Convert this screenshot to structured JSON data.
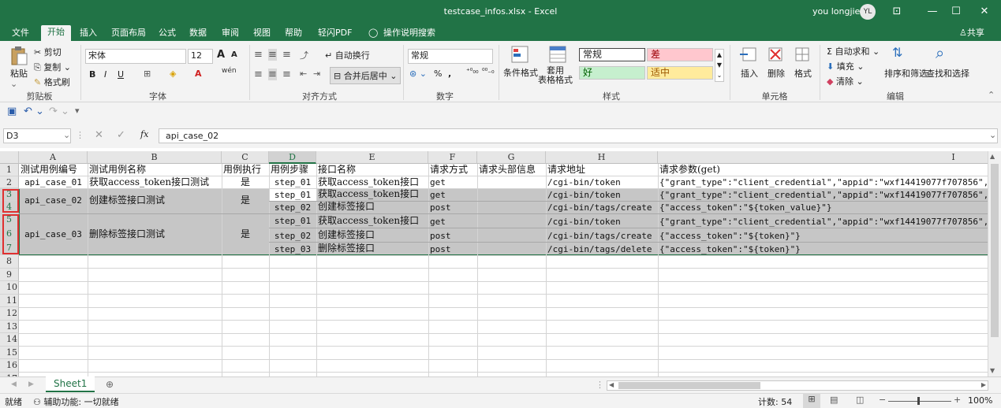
{
  "window": {
    "title": "testcase_infos.xlsx  -  Excel",
    "user": "you longjie",
    "avatar_initials": "YL",
    "controls": [
      "⊡",
      "—",
      "☐",
      "✕"
    ]
  },
  "tabs": [
    "文件",
    "开始",
    "插入",
    "页面布局",
    "公式",
    "数据",
    "审阅",
    "视图",
    "帮助",
    "轻闪PDF",
    "操作说明搜索"
  ],
  "share_label": "共享",
  "ribbon": {
    "clipboard": {
      "paste": "粘贴",
      "cut": "剪切",
      "copy": "复制",
      "format_painter": "格式刷",
      "group": "剪贴板"
    },
    "font": {
      "name": "宋体",
      "size": "12",
      "grow": "A",
      "shrink": "A",
      "bold": "B",
      "italic": "I",
      "underline": "U",
      "wen": "wén",
      "group": "字体"
    },
    "alignment": {
      "wrap": "自动换行",
      "merge": "合并后居中",
      "group": "对齐方式"
    },
    "number": {
      "format": "常规",
      "percent": "%",
      "comma": ",",
      "group": "数字"
    },
    "styles": {
      "cond_format": "条件格式",
      "table_format": "套用\n表格格式",
      "normal": "常规",
      "bad": "差",
      "good": "好",
      "neutral": "适中",
      "group": "样式"
    },
    "cells": {
      "insert": "插入",
      "delete": "删除",
      "format": "格式",
      "group": "单元格"
    },
    "editing": {
      "autosum": "自动求和",
      "fill": "填充",
      "clear": "清除",
      "sort": "排序和筛选",
      "find": "查找和选择",
      "group": "编辑"
    }
  },
  "formula_bar": {
    "name_box": "D3",
    "fx": "fx",
    "value": "api_case_02"
  },
  "columns": [
    "A",
    "B",
    "C",
    "D",
    "E",
    "F",
    "G",
    "H",
    "I"
  ],
  "rows_numbers": [
    "1",
    "2",
    "3",
    "4",
    "5",
    "6",
    "7",
    "8",
    "9",
    "10",
    "11",
    "12",
    "13",
    "14",
    "15",
    "16",
    "17"
  ],
  "cells": {
    "r1": {
      "a": "测试用例编号",
      "b": "测试用例名称",
      "c": "用例执行",
      "d": "用例步骤",
      "e": "接口名称",
      "f": "请求方式",
      "g": "请求头部信息",
      "h": "请求地址",
      "i": "请求参数(get)"
    },
    "r2": {
      "a": "api_case_01",
      "b": "获取access_token接口测试",
      "c": "是",
      "d": "step_01",
      "e": "获取access_token接口",
      "f": "get",
      "h": "/cgi-bin/token",
      "i": "{\"grant_type\":\"client_credential\",\"appid\":\"wxf14419077f707856\",\""
    },
    "r3": {
      "d": "step_01",
      "e": "获取access_token接口",
      "f": "get",
      "h": "/cgi-bin/token",
      "i": "{\"grant_type\":\"client_credential\",\"appid\":\"wxf14419077f707856\",\""
    },
    "r4": {
      "d": "step_02",
      "e": "创建标签接口",
      "f": "post",
      "h": "/cgi-bin/tags/create",
      "i": "{\"access_token\":\"${token_value}\"}"
    },
    "m34": {
      "a": "api_case_02",
      "b": "创建标签接口测试",
      "c": "是"
    },
    "r5": {
      "d": "step_01",
      "e": "获取access_token接口",
      "f": "get",
      "h": "/cgi-bin/token",
      "i": "{\"grant_type\":\"client_credential\",\"appid\":\"wxf14419077f707856\",\""
    },
    "r6": {
      "d": "step_02",
      "e": "创建标签接口",
      "f": "post",
      "h": "/cgi-bin/tags/create",
      "i": "{\"access_token\":\"${token}\"}"
    },
    "r7": {
      "d": "step_03",
      "e": "删除标签接口",
      "f": "post",
      "h": "/cgi-bin/tags/delete",
      "i": "{\"access_token\":\"${token}\"}"
    },
    "m567": {
      "a": "api_case_03",
      "b": "删除标签接口测试",
      "c": "是"
    }
  },
  "sheet_tab": "Sheet1",
  "status": {
    "ready": "就绪",
    "accessibility": "辅助功能: 一切就绪",
    "count": "计数: 54",
    "zoom": "100%"
  },
  "colors": {
    "accent": "#217346",
    "selection": "#c6c6c6",
    "error_box": "#e03030"
  }
}
